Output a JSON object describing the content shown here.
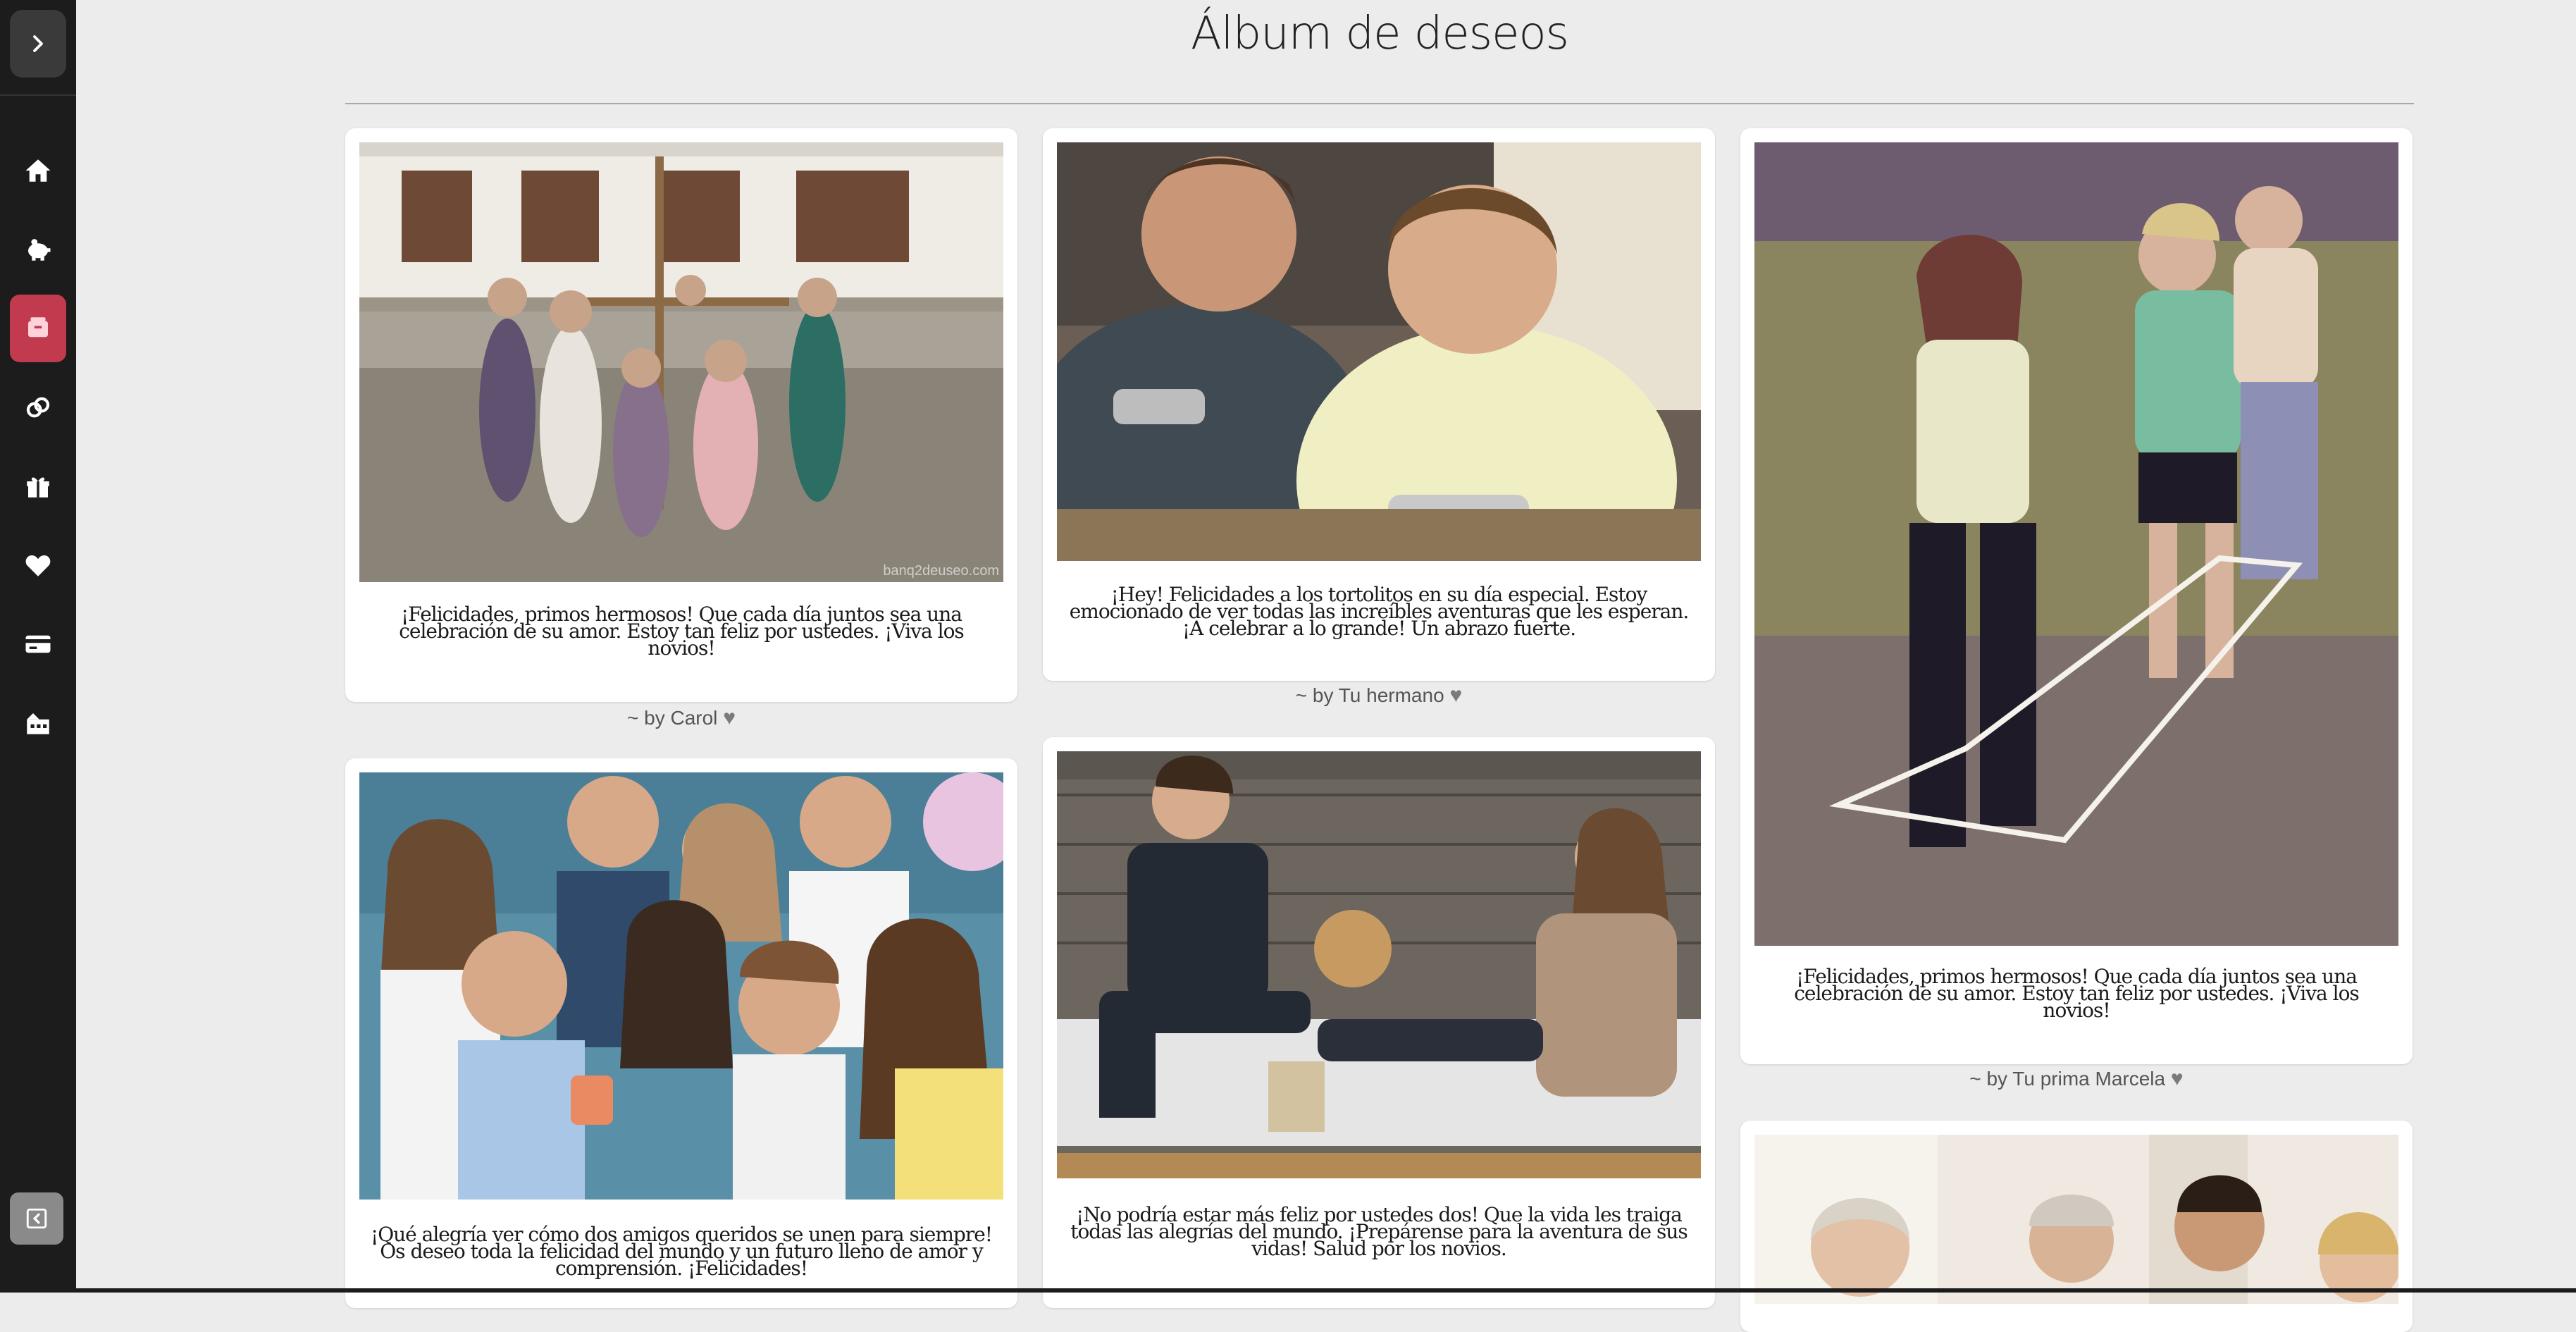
{
  "page": {
    "title": "Álbum de deseos"
  },
  "sidebar": {
    "toggle_icon": "chevron-right-icon",
    "items": [
      {
        "icon": "home-icon",
        "active": false
      },
      {
        "icon": "piggy-bank-icon",
        "active": false
      },
      {
        "icon": "album-icon",
        "active": true
      },
      {
        "icon": "rings-icon",
        "active": false
      },
      {
        "icon": "gift-icon",
        "active": false
      },
      {
        "icon": "heart-icon",
        "active": false
      },
      {
        "icon": "credit-card-icon",
        "active": false
      },
      {
        "icon": "hotel-icon",
        "active": false
      }
    ],
    "collapse_icon": "collapse-left-icon",
    "active_color": "#c23a4d"
  },
  "wishes": [
    {
      "message": "¡Felicidades, primos hermosos! Que cada día juntos sea una celebración de su amor. Estoy tan feliz por ustedes. ¡Viva los novios!",
      "author": "~ by Carol",
      "watermark": "banq2deuseo.com"
    },
    {
      "message": "¡Hey! Felicidades a los tortolitos en su día especial. Estoy emocionado de ver todas las increíbles aventuras que les esperan. ¡A celebrar a lo grande! Un abrazo fuerte.",
      "author": "~ by Tu hermano"
    },
    {
      "message": "¡Felicidades, primos hermosos! Que cada día juntos sea una celebración de su amor. Estoy tan feliz por ustedes. ¡Viva los novios!",
      "author": "~ by Tu prima Marcela"
    },
    {
      "message": "¡Qué alegría ver cómo dos amigos queridos se unen para siempre! Os deseo toda la felicidad del mundo y un futuro lleno de amor y comprensión. ¡Felicidades!"
    },
    {
      "message": "¡No podría estar más feliz por ustedes dos! Que la vida les traiga todas las alegrías del mundo. ¡Prepárense para la aventura de sus vidas! Salud por los novios."
    },
    {
      "message": ""
    }
  ]
}
